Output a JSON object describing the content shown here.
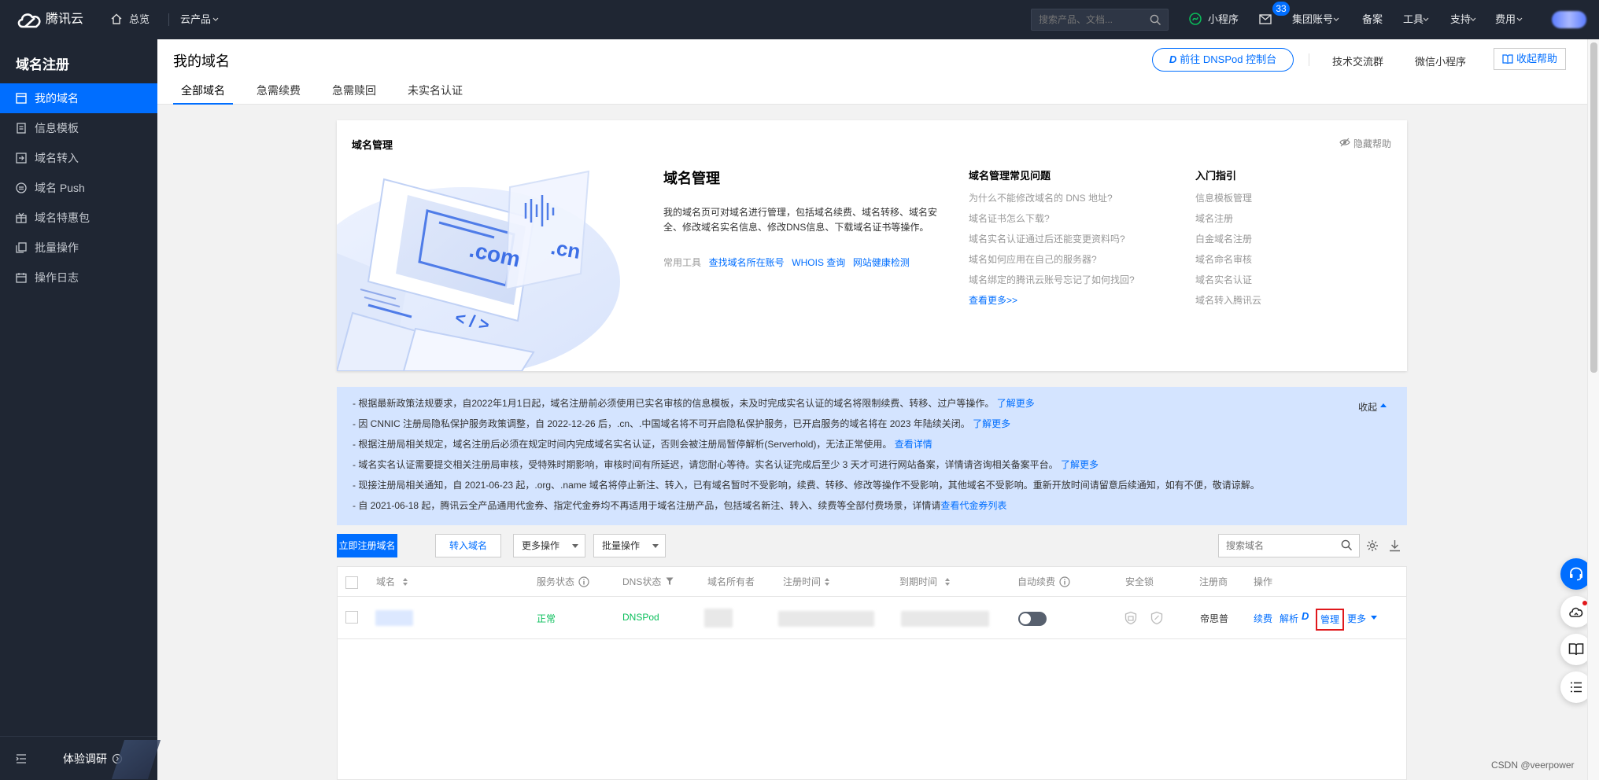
{
  "topbar": {
    "brand": "腾讯云",
    "overview": "总览",
    "products": "云产品",
    "search_placeholder": "搜索产品、文档...",
    "mini_program": "小程序",
    "message_count": "33",
    "account": "集团账号",
    "filing": "备案",
    "tools": "工具",
    "support": "支持",
    "billing": "费用"
  },
  "sidebar": {
    "title": "域名注册",
    "items": [
      {
        "label": "我的域名"
      },
      {
        "label": "信息模板"
      },
      {
        "label": "域名转入"
      },
      {
        "label": "域名 Push"
      },
      {
        "label": "域名特惠包"
      },
      {
        "label": "批量操作"
      },
      {
        "label": "操作日志"
      }
    ],
    "footer_label": "体验调研"
  },
  "header": {
    "title": "我的域名",
    "tabs": [
      {
        "label": "全部域名"
      },
      {
        "label": "急需续费"
      },
      {
        "label": "急需赎回"
      },
      {
        "label": "未实名认证"
      }
    ],
    "dnspod_button": "前往 DNSPod 控制台",
    "tech_forum": "技术交流群",
    "wechat_mini": "微信小程序",
    "collapse_help": "收起帮助"
  },
  "intro": {
    "card_title": "域名管理",
    "hide_help": "隐藏帮助",
    "illustration_text1": ".com",
    "illustration_text2": ".cn",
    "illustration_text3": "< / >",
    "heading": "域名管理",
    "desc": "我的域名页可对域名进行管理，包括域名续费、域名转移、域名安全、修改域名实名信息、修改DNS信息、下载域名证书等操作。",
    "tools_label": "常用工具",
    "tools": [
      "查找域名所在账号",
      "WHOIS 查询",
      "网站健康检测"
    ],
    "faq_title": "域名管理常见问题",
    "faq": [
      "为什么不能修改域名的 DNS 地址?",
      "域名证书怎么下载?",
      "域名实名认证通过后还能变更资料吗?",
      "域名如何应用在自己的服务器?",
      "域名绑定的腾讯云账号忘记了如何找回?"
    ],
    "faq_more": "查看更多>>",
    "guide_title": "入门指引",
    "guide": [
      "信息模板管理",
      "域名注册",
      "白金域名注册",
      "域名命名审核",
      "域名实名认证",
      "域名转入腾讯云"
    ]
  },
  "notice": {
    "collapse": "收起",
    "lines": [
      {
        "text": "- 根据最新政策法规要求，自2022年1月1日起，域名注册前必须使用已实名审核的信息模板，未及时完成实名认证的域名将限制续费、转移、过户等操作。",
        "link": "了解更多"
      },
      {
        "text": "- 因 CNNIC 注册局隐私保护服务政策调整，自 2022-12-26 后，.cn、.中国域名将不可开启隐私保护服务，已开启服务的域名将在 2023 年陆续关闭。",
        "link": "了解更多"
      },
      {
        "text": "- 根据注册局相关规定，域名注册后必须在规定时间内完成域名实名认证，否则会被注册局暂停解析(Serverhold)，无法正常使用。",
        "link": "查看详情"
      },
      {
        "text": "- 域名实名认证需要提交相关注册局审核，受特殊时期影响，审核时间有所延迟，请您耐心等待。实名认证完成后至少 3 天才可进行网站备案，详情请咨询相关备案平台。",
        "link": "了解更多"
      },
      {
        "text": "- 现接注册局相关通知，自 2021-06-23 起，.org、.name 域名将停止新注、转入，已有域名暂时不受影响，续费、转移、修改等操作不受影响，其他域名不受影响。重新开放时间请留意后续通知，如有不便，敬请谅解。",
        "link": ""
      },
      {
        "text": "- 自 2021-06-18 起，腾讯云全产品通用代金券、指定代金券均不再适用于域名注册产品，包括域名新注、转入、续费等全部付费场景，详情请",
        "link": "查看代金券列表"
      }
    ]
  },
  "toolbar": {
    "register": "立即注册域名",
    "transfer_in": "转入域名",
    "more_ops": "更多操作",
    "batch_ops": "批量操作",
    "search_placeholder": "搜索域名"
  },
  "table": {
    "columns": [
      "域名",
      "服务状态",
      "DNS状态",
      "域名所有者",
      "注册时间",
      "到期时间",
      "自动续费",
      "安全锁",
      "注册商",
      "操作"
    ],
    "rows": [
      {
        "status": "正常",
        "dns": "DNSPod",
        "auto_renew": false,
        "registrar": "帝思普",
        "actions": [
          "续费",
          "解析",
          "管理",
          "更多"
        ]
      }
    ]
  },
  "watermark": "CSDN @veerpower",
  "colors": {
    "brand": "#006eff",
    "topbar": "#1f2633",
    "success": "#0abf5b",
    "highlight": "#e0181c"
  }
}
